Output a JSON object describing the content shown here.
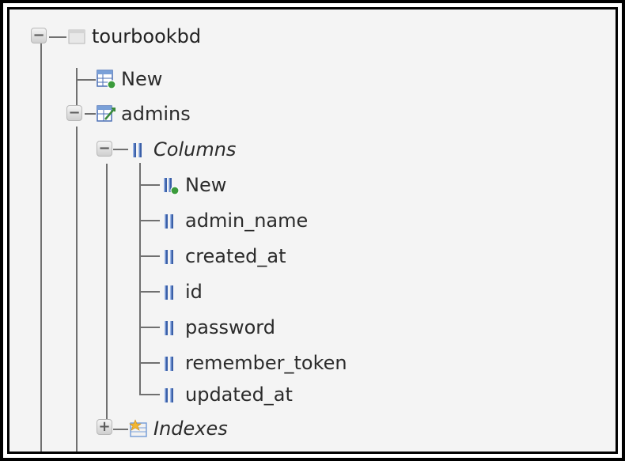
{
  "tree": {
    "database": {
      "label": "tourbookbd",
      "icon": "database-icon",
      "expanded": true
    },
    "db_new": {
      "label": "New",
      "icon": "new-table-icon"
    },
    "table": {
      "label": "admins",
      "icon": "table-icon",
      "expanded": true
    },
    "columns_folder": {
      "label": "Columns",
      "icon": "columns-icon",
      "expanded": true
    },
    "columns": [
      {
        "label": "New",
        "icon": "new-column-icon"
      },
      {
        "label": "admin_name",
        "icon": "column-icon"
      },
      {
        "label": "created_at",
        "icon": "column-icon"
      },
      {
        "label": "id",
        "icon": "column-icon"
      },
      {
        "label": "password",
        "icon": "column-icon"
      },
      {
        "label": "remember_token",
        "icon": "column-icon"
      },
      {
        "label": "updated_at",
        "icon": "column-icon"
      }
    ],
    "indexes_folder": {
      "label": "Indexes",
      "icon": "indexes-icon",
      "expanded": false
    }
  },
  "colors": {
    "column_icon_blue": "#3a5fa8",
    "new_badge_green": "#3b9b3b",
    "tree_line": "#707070",
    "background": "#f4f4f4"
  }
}
